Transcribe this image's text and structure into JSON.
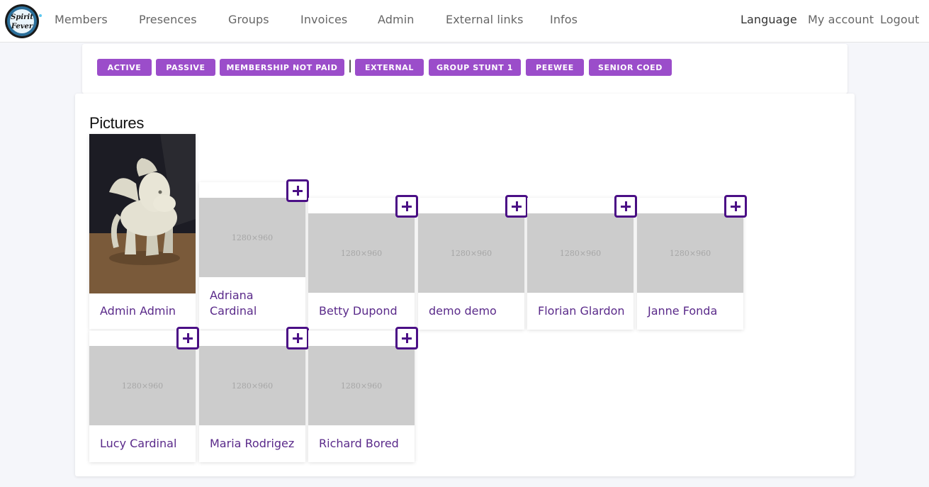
{
  "nav": {
    "items": [
      "Members",
      "Presences",
      "Groups",
      "Invoices",
      "Admin",
      "External links",
      "Infos"
    ],
    "language": "Language",
    "my_account": "My account",
    "logout": "Logout"
  },
  "logo": {
    "text_top": "Spirit",
    "text_bottom": "Fever"
  },
  "filters": {
    "chips": [
      "ACTIVE",
      "PASSIVE",
      "MEMBERSHIP NOT PAID",
      "EXTERNAL",
      "GROUP STUNT 1",
      "PEEWEE",
      "SENIOR COED"
    ],
    "separator": "|",
    "accent_color": "#9b4dca"
  },
  "pictures": {
    "title": "Pictures",
    "placeholder_text": "1280×960",
    "members": [
      {
        "name": "Admin Admin",
        "has_photo": true
      },
      {
        "name": "Adriana Cardinal",
        "has_photo": false
      },
      {
        "name": "Betty Dupond",
        "has_photo": false
      },
      {
        "name": "demo demo",
        "has_photo": false
      },
      {
        "name": "Florian Glardon",
        "has_photo": false
      },
      {
        "name": "Janne Fonda",
        "has_photo": false
      },
      {
        "name": "Lucy Cardinal",
        "has_photo": false
      },
      {
        "name": "Maria Rodrigez",
        "has_photo": false
      },
      {
        "name": "Richard Bored",
        "has_photo": false
      }
    ],
    "add_icon": "plus-square-icon",
    "name_color": "#5a2a8a",
    "icon_color": "#4b0f86"
  }
}
